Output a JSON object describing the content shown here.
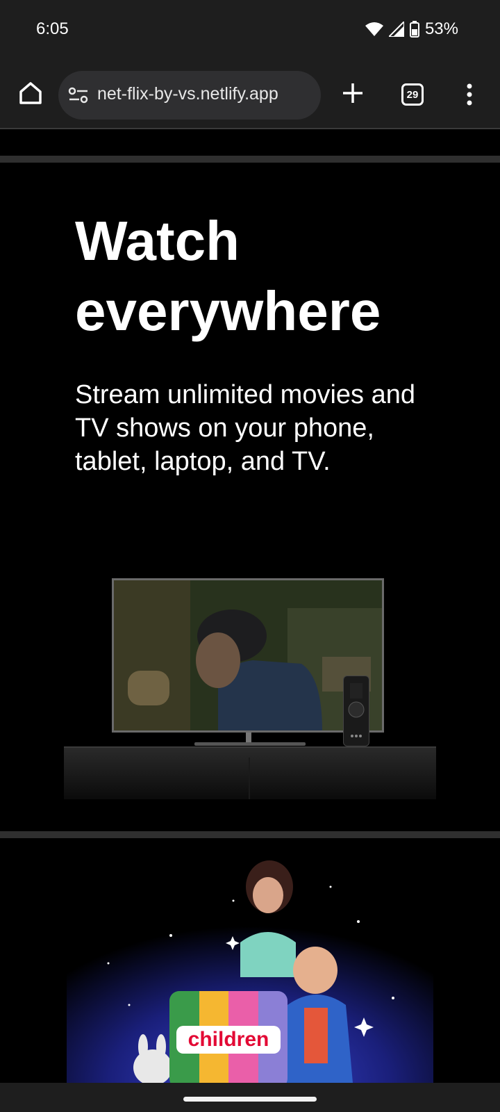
{
  "status_bar": {
    "time": "6:05",
    "battery_percent": "53%",
    "icons": [
      "wifi-icon",
      "cell-signal-icon",
      "battery-icon"
    ]
  },
  "browser": {
    "url": "net-flix-by-vs.netlify.app",
    "tab_count": "29",
    "icons": [
      "home-icon",
      "site-settings-icon",
      "plus-icon",
      "tabs-icon",
      "more-vert-icon"
    ]
  },
  "hero": {
    "title": "Watch everywhere",
    "subtitle": "Stream unlimited movies and TV shows on your phone, tablet, laptop, and TV."
  },
  "kids": {
    "label": "children",
    "card_colors": [
      "#3a9b4a",
      "#f5b731",
      "#ea5fa9",
      "#8b7fd6"
    ]
  },
  "colors": {
    "background": "#000000",
    "chrome": "#1e1e1e",
    "url_bar": "#2f2f31",
    "divider": "#2f2f2f",
    "brand_red": "#e30a35"
  }
}
